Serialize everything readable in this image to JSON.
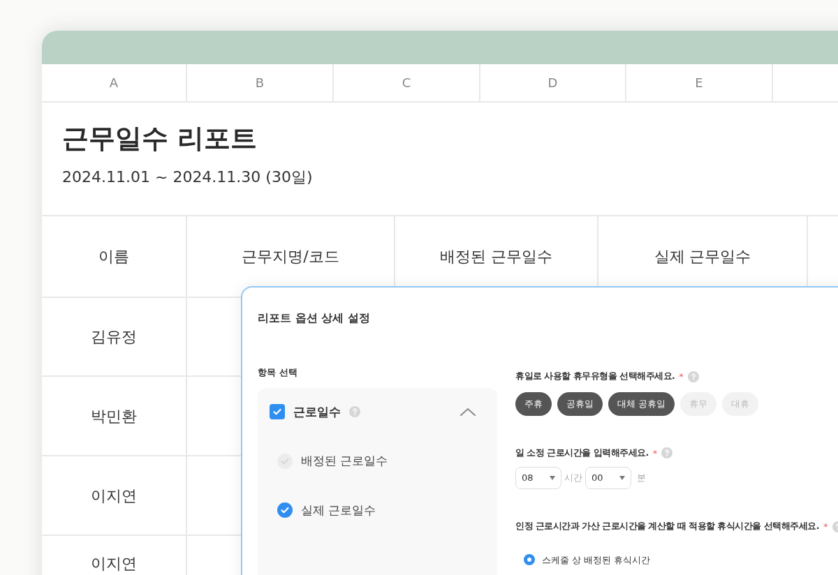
{
  "sheet": {
    "column_letters": [
      "A",
      "B",
      "C",
      "D",
      "E"
    ],
    "title": "근무일수 리포트",
    "period": "2024.11.01 ~ 2024.11.30 (30일)",
    "table": {
      "columns": [
        "이름",
        "근무지명/코드",
        "배정된 근무일수",
        "실제 근무일수"
      ],
      "rows": [
        {
          "name": "김유정"
        },
        {
          "name": "박민환"
        },
        {
          "name": "이지연"
        },
        {
          "name": "이지연"
        }
      ]
    }
  },
  "dialog": {
    "title": "리포트 옵션 상세 설정",
    "section_label": "항목 선택",
    "group": {
      "label": "근로일수",
      "checked": true,
      "expanded": true,
      "items": [
        {
          "label": "배정된 근로일수",
          "checked": true,
          "disabled": true
        },
        {
          "label": "실제 근로일수",
          "checked": true,
          "disabled": false
        }
      ]
    },
    "questions": [
      {
        "kind": "chips",
        "label": "휴일로 사용할 휴무유형을 선택해주세요.",
        "required_mark": "*",
        "options": [
          {
            "label": "주휴",
            "selected": true
          },
          {
            "label": "공휴일",
            "selected": true
          },
          {
            "label": "대체 공휴일",
            "selected": true
          },
          {
            "label": "휴무",
            "selected": false
          },
          {
            "label": "대휴",
            "selected": false
          }
        ]
      },
      {
        "kind": "time",
        "label": "일 소정 근로시간을 입력해주세요.",
        "required_mark": "*",
        "hours": "08",
        "hours_unit": "시간",
        "minutes": "00",
        "minutes_unit": "분"
      },
      {
        "kind": "radio",
        "label": "인정 근로시간과 가산 근로시간을 계산할 때 적용할 휴식시간을 선택해주세요.",
        "required_mark": "*",
        "options": [
          {
            "label": "스케줄 상 배정된 휴식시간",
            "selected": true
          }
        ]
      }
    ]
  }
}
